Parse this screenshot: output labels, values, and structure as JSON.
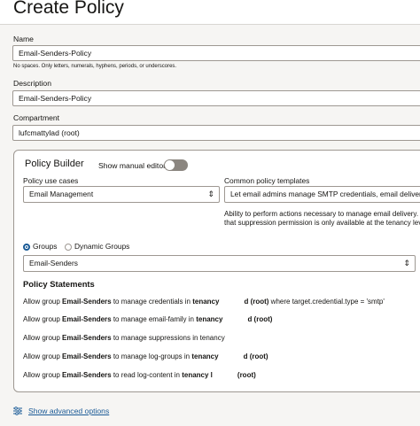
{
  "page": {
    "title": "Create Policy"
  },
  "form": {
    "name_label": "Name",
    "name_value": "Email-Senders-Policy",
    "name_hint": "No spaces. Only letters, numerals, hyphens, periods, or underscores.",
    "description_label": "Description",
    "description_value": "Email-Senders-Policy",
    "compartment_label": "Compartment",
    "compartment_value": "lufcmattylad (root)"
  },
  "builder": {
    "title": "Policy Builder",
    "manual_editor_label": "Show manual editor",
    "manual_editor_on": false,
    "use_cases_label": "Policy use cases",
    "use_case_value": "Email Management",
    "templates_label": "Common policy templates",
    "template_value": "Let email admins manage SMTP credentials, email delivery resources",
    "template_desc_1": "Ability to perform actions necessary to manage email delivery. This",
    "template_desc_2": "that suppression permission is only available at the tenancy level.",
    "groups_label": "Groups",
    "dynamic_groups_label": "Dynamic Groups",
    "selected_group": "Email-Senders",
    "statements_title": "Policy Statements",
    "statements": [
      {
        "prefix": "Allow group ",
        "group": "Email-Senders",
        "middle": " to manage credentials in ",
        "scope": "tenancy",
        "tail_bold": "d (root)",
        "tail": " where target.credential.type = 'smtp'"
      },
      {
        "prefix": "Allow group ",
        "group": "Email-Senders",
        "middle": " to manage email-family in ",
        "scope": "tenancy",
        "tail_bold": "d (root)",
        "tail": ""
      },
      {
        "prefix": "Allow group ",
        "group": "Email-Senders",
        "middle": " to manage suppressions in tenancy",
        "scope": "",
        "tail_bold": "",
        "tail": ""
      },
      {
        "prefix": "Allow group ",
        "group": "Email-Senders",
        "middle": " to manage log-groups in ",
        "scope": "tenancy",
        "tail_bold": "d (root)",
        "tail": ""
      },
      {
        "prefix": "Allow group ",
        "group": "Email-Senders",
        "middle": " to read log-content in ",
        "scope": "tenancy l",
        "tail_bold": "(root)",
        "tail": ""
      }
    ]
  },
  "footer": {
    "advanced_link": "Show advanced options"
  },
  "colors": {
    "link": "#1a5a96",
    "toggle_off": "#8b8680",
    "border": "#9e9892"
  }
}
